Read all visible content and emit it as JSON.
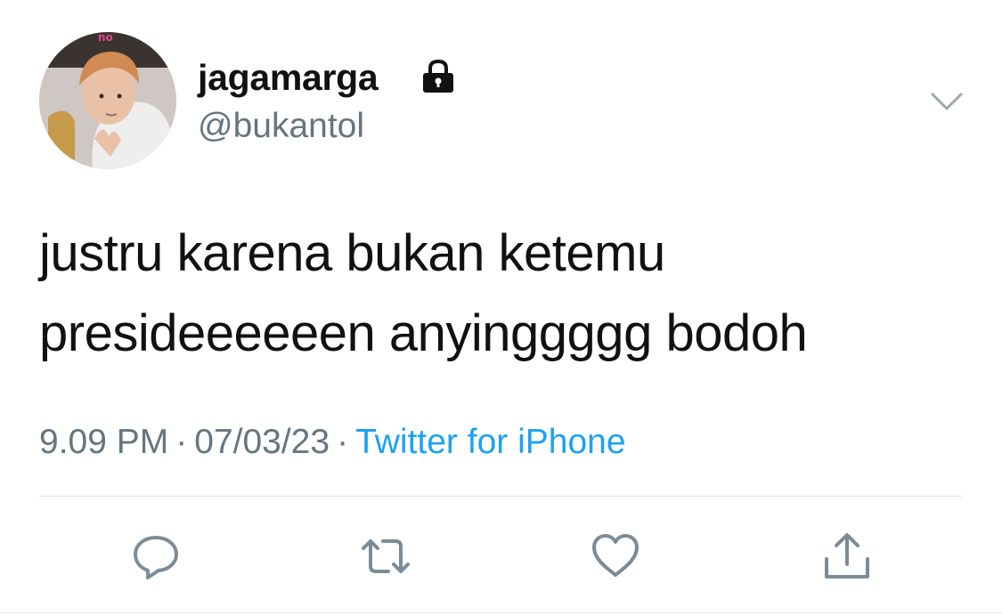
{
  "author": {
    "display_name": "jagamarga",
    "handle": "@bukantol",
    "protected": true,
    "avatar_icon": "profile-photo"
  },
  "tweet": {
    "text_lines": [
      "justru karena bukan ketemu",
      "presideeeeeen anyinggggg bodoh"
    ],
    "time": "9.09 PM",
    "date": "07/03/23",
    "source": "Twitter for iPhone",
    "separator": "·"
  },
  "actions": [
    {
      "name": "reply",
      "icon": "reply-icon"
    },
    {
      "name": "retweet",
      "icon": "retweet-icon"
    },
    {
      "name": "like",
      "icon": "heart-icon"
    },
    {
      "name": "share",
      "icon": "share-icon"
    }
  ],
  "colors": {
    "text": "#111111",
    "secondary": "#66757f",
    "link": "#1da1f2",
    "divider": "#dfe3e6",
    "icon": "#7b8b98"
  }
}
